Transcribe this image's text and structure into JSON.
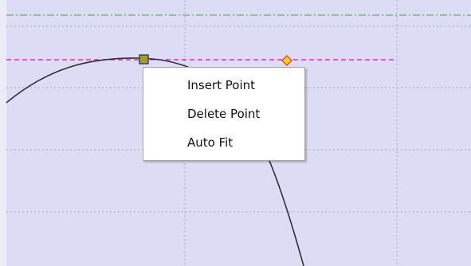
{
  "context_menu": {
    "items": [
      {
        "label": "Insert Point"
      },
      {
        "label": "Delete Point"
      },
      {
        "label": "Auto Fit"
      }
    ]
  },
  "colors": {
    "plot_background": "#dcdcf4",
    "grid": "#a9a9b8",
    "green_dashdot_line": "#59b859",
    "magenta_dashed_line": "#e000e0",
    "curve": "#303030",
    "control_point_fill": "#a0a020",
    "control_point_border": "#1f2f80",
    "limit_marker": "#ffd400",
    "limit_marker_border": "#e03030"
  },
  "icons": {
    "control_point": "square-handle-icon",
    "limit_marker": "diamond-marker-icon"
  }
}
